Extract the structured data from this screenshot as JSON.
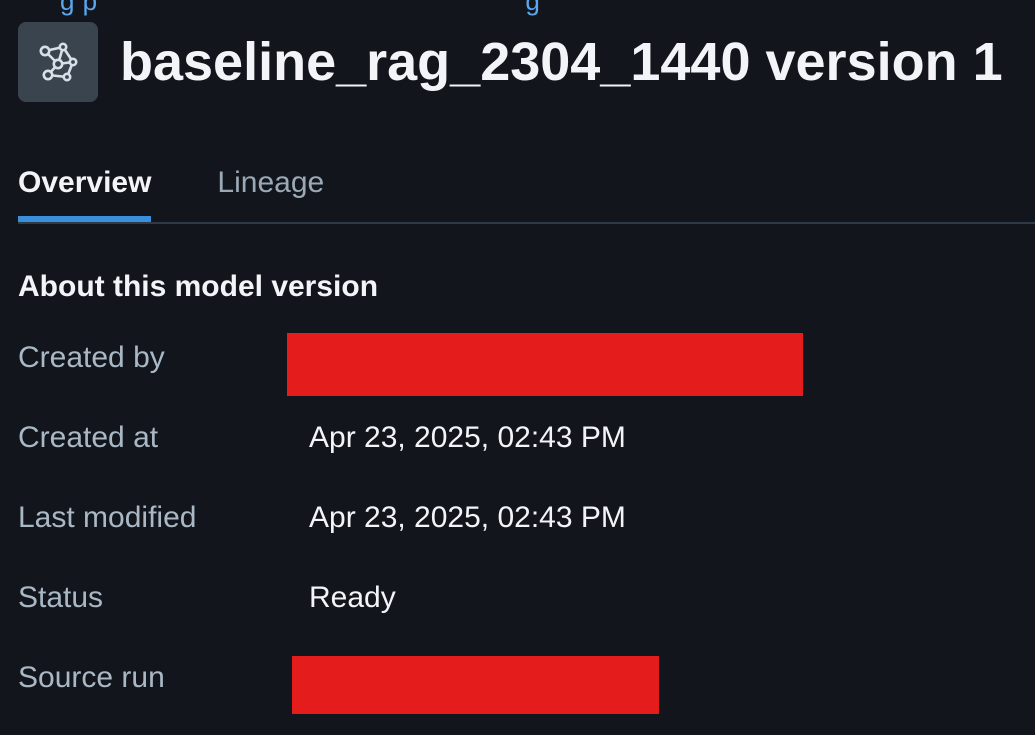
{
  "breadcrumb": {
    "items": [
      "g p",
      "g"
    ]
  },
  "header": {
    "icon": "model-graph-icon",
    "title": "baseline_rag_2304_1440 version 1"
  },
  "tabs": [
    {
      "label": "Overview",
      "active": true
    },
    {
      "label": "Lineage",
      "active": false
    }
  ],
  "section": {
    "heading": "About this model version"
  },
  "details": {
    "created_by": {
      "label": "Created by",
      "value_redacted": true
    },
    "created_at": {
      "label": "Created at",
      "value": "Apr 23, 2025, 02:43 PM"
    },
    "last_modified": {
      "label": "Last modified",
      "value": "Apr 23, 2025, 02:43 PM"
    },
    "status": {
      "label": "Status",
      "value": "Ready"
    },
    "source_run": {
      "label": "Source run",
      "value_redacted": true
    }
  },
  "colors": {
    "background": "#12161c",
    "accent": "#3a8fdd",
    "redaction": "#e51c1c",
    "icon_bg": "#3a444f"
  }
}
